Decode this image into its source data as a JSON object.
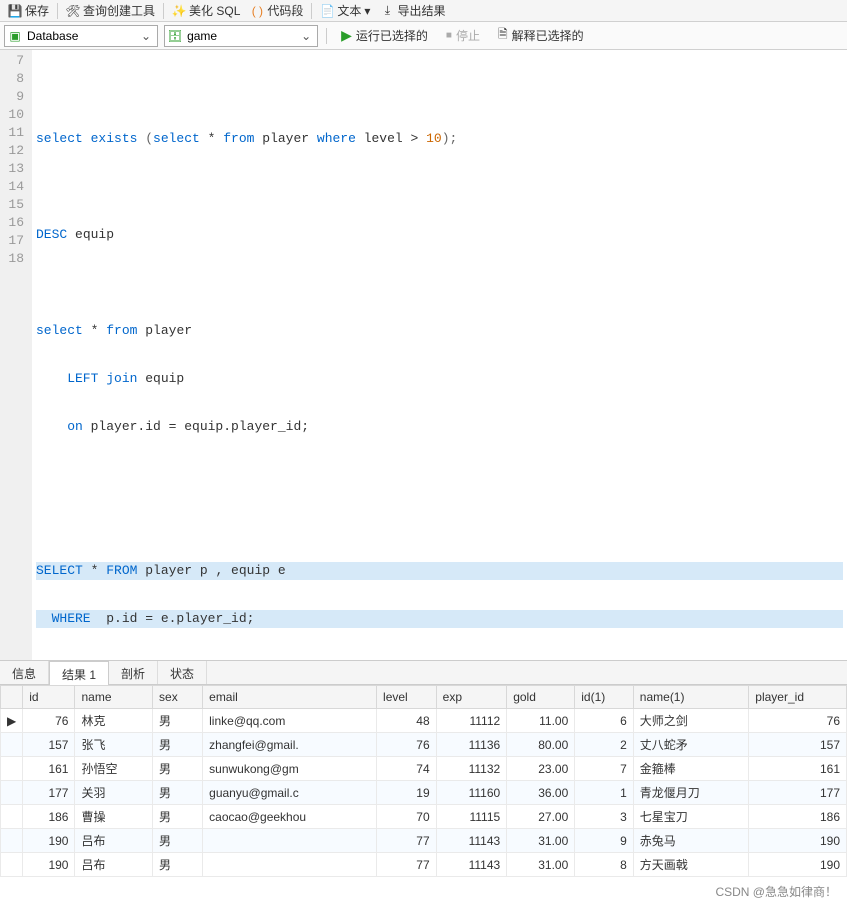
{
  "toolbar": {
    "save": "保存",
    "query_builder": "查询创建工具",
    "beautify": "美化 SQL",
    "snippet": "代码段",
    "text": "文本",
    "export": "导出结果"
  },
  "connbar": {
    "db_label": "Database",
    "schema_label": "game",
    "run": "运行已选择的",
    "stop": "停止",
    "explain": "解释已选择的"
  },
  "code": {
    "l7": "7",
    "l8": "8",
    "l9": "9",
    "l10": "10",
    "l11": "11",
    "l12": "12",
    "l13": "13",
    "l14": "14",
    "l15": "15",
    "l16": "16",
    "l17": "17",
    "l18": "18",
    "line8_a": "select exists ",
    "line8_b": "(",
    "line8_c": "select",
    "line8_d": " * ",
    "line8_e": "from",
    "line8_f": " player ",
    "line8_g": "where",
    "line8_h": " level > ",
    "line8_i": "10",
    "line8_j": ");",
    "line10_a": "DESC",
    "line10_b": " equip",
    "line12_a": "select",
    "line12_b": " * ",
    "line12_c": "from",
    "line12_d": " player",
    "line13_a": "    LEFT join",
    "line13_b": " equip",
    "line14_a": "    on",
    "line14_b": " player.id = equip.player_id;",
    "line17_a": "SELECT",
    "line17_b": " * ",
    "line17_c": "FROM",
    "line17_d": " player p , equip e",
    "line18_a": "  WHERE ",
    "line18_b": " p.id = e.player_id;"
  },
  "tabs": {
    "info": "信息",
    "result1": "结果 1",
    "profile": "剖析",
    "status": "状态"
  },
  "columns": [
    "id",
    "name",
    "sex",
    "email",
    "level",
    "exp",
    "gold",
    "id(1)",
    "name(1)",
    "player_id"
  ],
  "rows": [
    {
      "ptr": "▶",
      "id": "76",
      "name": "林克",
      "sex": "男",
      "email": "linke@qq.com",
      "level": "48",
      "exp": "11112",
      "gold": "11.00",
      "id1": "6",
      "name1": "大师之剑",
      "player_id": "76"
    },
    {
      "ptr": "",
      "id": "157",
      "name": "张飞",
      "sex": "男",
      "email": "zhangfei@gmail.",
      "level": "76",
      "exp": "11136",
      "gold": "80.00",
      "id1": "2",
      "name1": "丈八蛇矛",
      "player_id": "157"
    },
    {
      "ptr": "",
      "id": "161",
      "name": "孙悟空",
      "sex": "男",
      "email": "sunwukong@gm",
      "level": "74",
      "exp": "11132",
      "gold": "23.00",
      "id1": "7",
      "name1": "金箍棒",
      "player_id": "161"
    },
    {
      "ptr": "",
      "id": "177",
      "name": "关羽",
      "sex": "男",
      "email": "guanyu@gmail.c",
      "level": "19",
      "exp": "11160",
      "gold": "36.00",
      "id1": "1",
      "name1": "青龙偃月刀",
      "player_id": "177"
    },
    {
      "ptr": "",
      "id": "186",
      "name": "曹操",
      "sex": "男",
      "email": "caocao@geekhou",
      "level": "70",
      "exp": "11115",
      "gold": "27.00",
      "id1": "3",
      "name1": "七星宝刀",
      "player_id": "186"
    },
    {
      "ptr": "",
      "id": "190",
      "name": "吕布",
      "sex": "男",
      "email": "",
      "level": "77",
      "exp": "11143",
      "gold": "31.00",
      "id1": "9",
      "name1": "赤兔马",
      "player_id": "190"
    },
    {
      "ptr": "",
      "id": "190",
      "name": "吕布",
      "sex": "男",
      "email": "",
      "level": "77",
      "exp": "11143",
      "gold": "31.00",
      "id1": "8",
      "name1": "方天画戟",
      "player_id": "190"
    }
  ],
  "footer": "CSDN @急急如律商！"
}
